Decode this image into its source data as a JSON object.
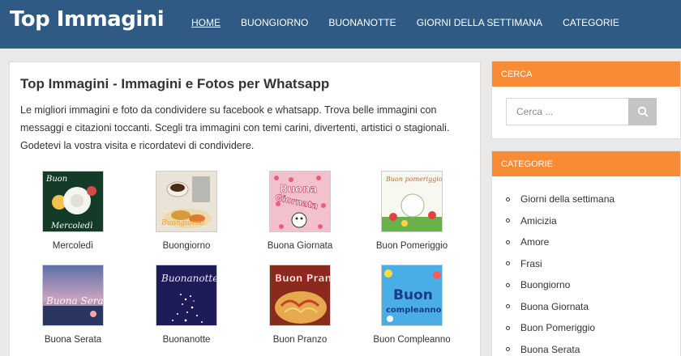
{
  "header": {
    "logo": "Top Immagini",
    "nav": [
      {
        "label": "HOME",
        "active": true
      },
      {
        "label": "BUONGIORNO",
        "active": false
      },
      {
        "label": "BUONANOTTE",
        "active": false
      },
      {
        "label": "GIORNI DELLA SETTIMANA",
        "active": false
      },
      {
        "label": "CATEGORIE",
        "active": false
      }
    ]
  },
  "main": {
    "title": "Top Immagini - Immagini e Fotos per Whatsapp",
    "intro": "Le migliori immagini e foto da condividere su facebook e whatsapp. Trova belle immagini con messaggi e citazioni toccanti. Scegli tra immagini con temi carini, divertenti, artistici o stagionali. Godetevi la vostra visita e ricordatevi di condividere.",
    "gallery": [
      {
        "caption": "Mercoledì",
        "overlay": "Buon Mercoledì"
      },
      {
        "caption": "Buongiorno",
        "overlay": "Buongiorno"
      },
      {
        "caption": "Buona Giornata",
        "overlay": "Buona Giornata"
      },
      {
        "caption": "Buon Pomeriggio",
        "overlay": "Buon pomeriggio"
      },
      {
        "caption": "Buona Serata",
        "overlay": "Buona Serata"
      },
      {
        "caption": "Buonanotte",
        "overlay": "Buonanotte"
      },
      {
        "caption": "Buon Pranzo",
        "overlay": "Buon Pranzo"
      },
      {
        "caption": "Buon Compleanno",
        "overlay": "Buon compleanno"
      }
    ]
  },
  "sidebar": {
    "search": {
      "heading": "CERCA",
      "placeholder": "Cerca ..."
    },
    "categories": {
      "heading": "CATEGORIE",
      "items": [
        "Giorni della settimana",
        "Amicizia",
        "Amore",
        "Frasi",
        "Buongiorno",
        "Buona Giornata",
        "Buon Pomeriggio",
        "Buona Serata"
      ]
    }
  },
  "colors": {
    "header": "#2e5a84",
    "accent": "#f98b34",
    "search_button": "#c4c4c4"
  }
}
